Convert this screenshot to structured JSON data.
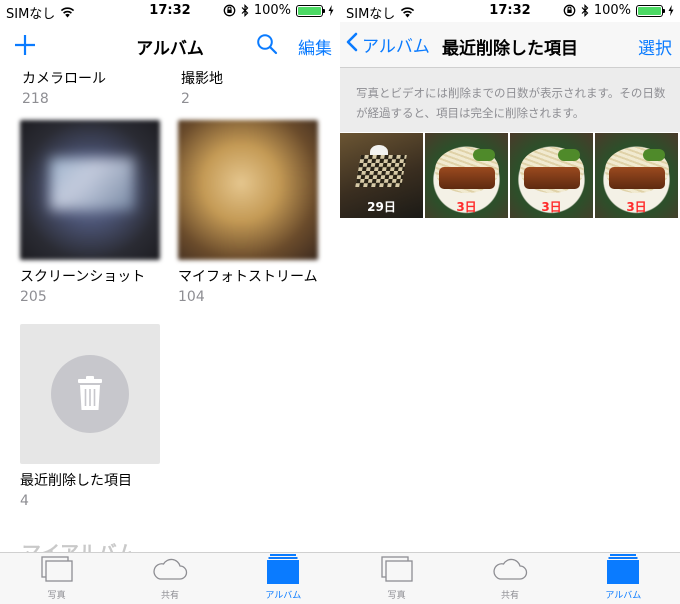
{
  "colors": {
    "accent": "#0a7bff",
    "battery": "#4cd964",
    "deleted_days_red": "#ff2a2a",
    "secondary_text": "#8e8e93"
  },
  "status_bar": {
    "carrier": "SIMなし",
    "time": "17:32",
    "battery_text": "100%",
    "battery_level": 1.0
  },
  "left_screen": {
    "title": "アルバム",
    "edit_label": "編集",
    "albums": [
      {
        "name": "カメラロール",
        "count": "218"
      },
      {
        "name": "撮影地",
        "count": "2"
      },
      {
        "name": "スクリーンショット",
        "count": "205"
      },
      {
        "name": "マイフォトストリーム",
        "count": "104"
      },
      {
        "name": "最近削除した項目",
        "count": "4"
      }
    ],
    "section_header": "マイアルバム"
  },
  "right_screen": {
    "back_label": "アルバム",
    "title": "最近削除した項目",
    "select_label": "選択",
    "info": "写真とビデオには削除までの日数が表示されます。その日数が経過すると、項目は完全に削除されます。",
    "photos": [
      {
        "days": "29日"
      },
      {
        "days": "3日"
      },
      {
        "days": "3日"
      },
      {
        "days": "3日"
      }
    ]
  },
  "tab_bar": {
    "tabs": [
      {
        "label": "写真",
        "icon": "photos-icon"
      },
      {
        "label": "共有",
        "icon": "cloud-icon"
      },
      {
        "label": "アルバム",
        "icon": "albums-icon",
        "active": true
      }
    ]
  }
}
